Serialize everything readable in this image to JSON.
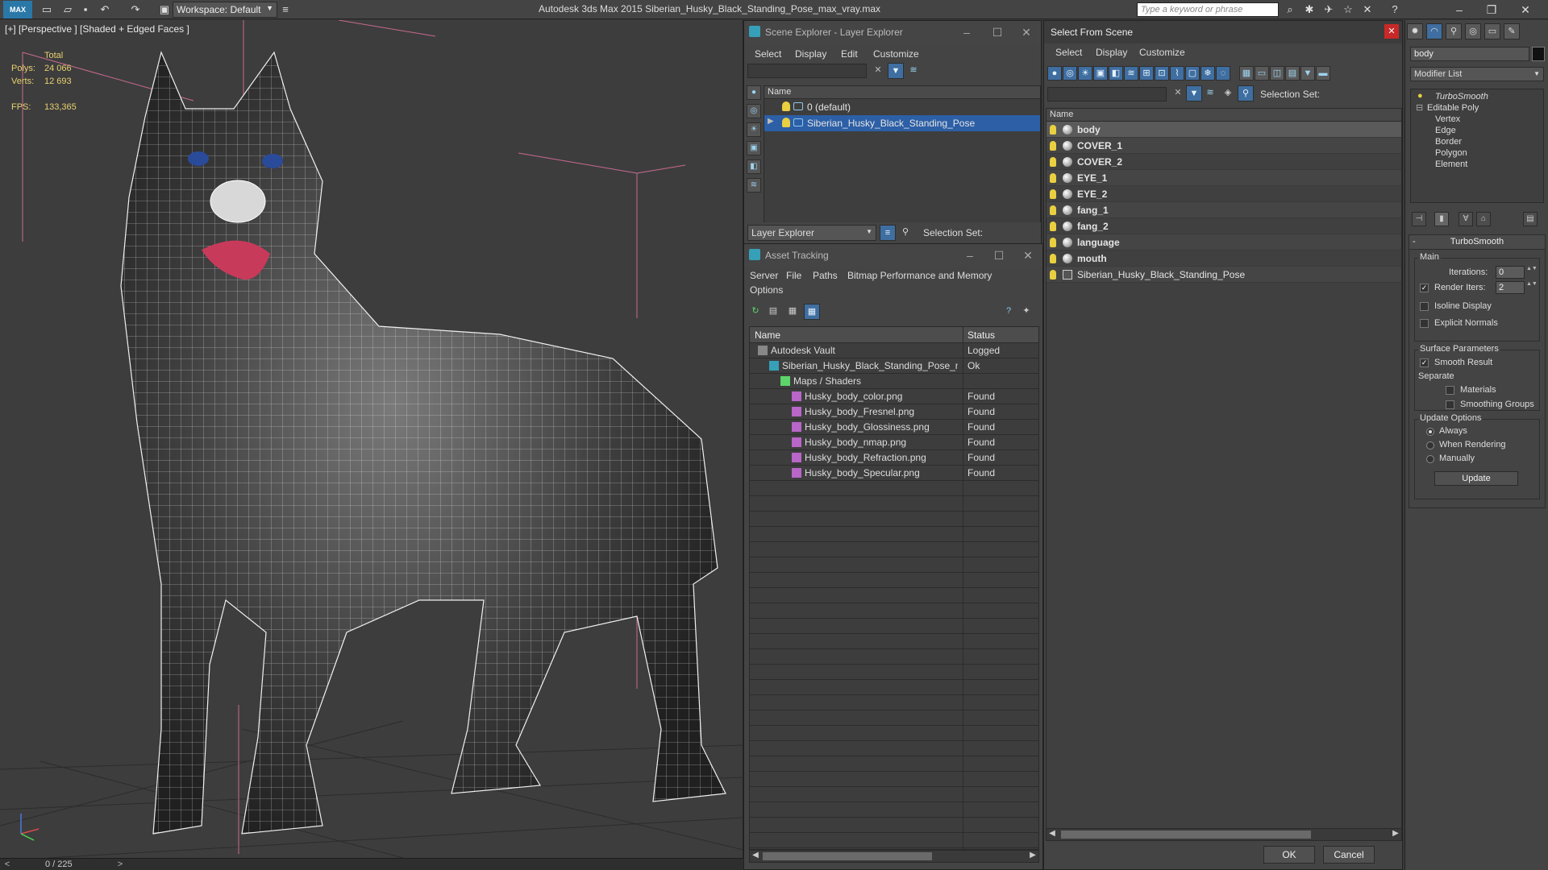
{
  "titlebar": {
    "logo": "MAX",
    "workspace": "Workspace: Default",
    "app_title": "Autodesk 3ds Max  2015    Siberian_Husky_Black_Standing_Pose_max_vray.max",
    "search_placeholder": "Type a keyword or phrase"
  },
  "viewport": {
    "label": "[+] [Perspective ] [Shaded + Edged Faces ]",
    "stats": {
      "total_label": "Total",
      "polys_label": "Polys:",
      "polys_value": "24 066",
      "verts_label": "Verts:",
      "verts_value": "12 693",
      "fps_label": "FPS:",
      "fps_value": "133,365"
    },
    "axis": {
      "x": "x",
      "y": "y",
      "z": "z"
    }
  },
  "timeline": {
    "frame": "0 / 225",
    "prev": "<",
    "next": ">"
  },
  "scene_explorer": {
    "title": "Scene Explorer - Layer Explorer",
    "menu": [
      "Select",
      "Display",
      "Edit",
      "Customize"
    ],
    "column": "Name",
    "rows": [
      {
        "name": "0 (default)",
        "selected": false
      },
      {
        "name": "Siberian_Husky_Black_Standing_Pose",
        "selected": true
      }
    ],
    "explorer_dropdown": "Layer Explorer",
    "selection_set_label": "Selection Set:"
  },
  "asset_tracking": {
    "title": "Asset Tracking",
    "menu": [
      "Server",
      "File",
      "Paths",
      "Bitmap Performance and Memory",
      "Options"
    ],
    "columns": {
      "name": "Name",
      "status": "Status"
    },
    "rows": [
      {
        "name": "Autodesk Vault",
        "status": "Logged",
        "indent": 0,
        "icon": "vault-icon"
      },
      {
        "name": "Siberian_Husky_Black_Standing_Pose_max_vray....",
        "status": "Ok",
        "indent": 1,
        "icon": "max-file-icon"
      },
      {
        "name": "Maps / Shaders",
        "status": "",
        "indent": 2,
        "icon": "maps-icon"
      },
      {
        "name": "Husky_body_color.png",
        "status": "Found",
        "indent": 3,
        "icon": "png-icon"
      },
      {
        "name": "Husky_body_Fresnel.png",
        "status": "Found",
        "indent": 3,
        "icon": "png-icon"
      },
      {
        "name": "Husky_body_Glossiness.png",
        "status": "Found",
        "indent": 3,
        "icon": "png-icon"
      },
      {
        "name": "Husky_body_nmap.png",
        "status": "Found",
        "indent": 3,
        "icon": "png-icon"
      },
      {
        "name": "Husky_body_Refraction.png",
        "status": "Found",
        "indent": 3,
        "icon": "png-icon"
      },
      {
        "name": "Husky_body_Specular.png",
        "status": "Found",
        "indent": 3,
        "icon": "png-icon"
      }
    ]
  },
  "select_from_scene": {
    "title": "Select From Scene",
    "menu": [
      "Select",
      "Display",
      "Customize"
    ],
    "selection_set_label": "Selection Set:",
    "column": "Name",
    "rows": [
      {
        "name": "body",
        "selected": true,
        "kind": "object"
      },
      {
        "name": "COVER_1",
        "selected": false,
        "kind": "object"
      },
      {
        "name": "COVER_2",
        "selected": false,
        "kind": "object"
      },
      {
        "name": "EYE_1",
        "selected": false,
        "kind": "object"
      },
      {
        "name": "EYE_2",
        "selected": false,
        "kind": "object"
      },
      {
        "name": "fang_1",
        "selected": false,
        "kind": "object"
      },
      {
        "name": "fang_2",
        "selected": false,
        "kind": "object"
      },
      {
        "name": "language",
        "selected": false,
        "kind": "object"
      },
      {
        "name": "mouth",
        "selected": false,
        "kind": "object"
      },
      {
        "name": "Siberian_Husky_Black_Standing_Pose",
        "selected": false,
        "kind": "group"
      }
    ],
    "ok": "OK",
    "cancel": "Cancel"
  },
  "command_panel": {
    "object_name": "body",
    "modifier_list": "Modifier List",
    "stack": {
      "turbosmooth": "TurboSmooth",
      "editable_poly": "Editable Poly",
      "sub": [
        "Vertex",
        "Edge",
        "Border",
        "Polygon",
        "Element"
      ]
    },
    "rollout_title": "TurboSmooth",
    "main_label": "Main",
    "iterations_label": "Iterations:",
    "iterations_value": "0",
    "render_iters_label": "Render Iters:",
    "render_iters_value": "2",
    "isoline_label": "Isoline Display",
    "explicit_normals_label": "Explicit Normals",
    "surface_params_label": "Surface Parameters",
    "smooth_result_label": "Smooth Result",
    "separate_label": "Separate",
    "materials_label": "Materials",
    "smoothing_groups_label": "Smoothing Groups",
    "update_options_label": "Update Options",
    "always_label": "Always",
    "when_rendering_label": "When Rendering",
    "manually_label": "Manually",
    "update_button": "Update"
  },
  "colors": {
    "selection_blue": "#2c5fa6",
    "stats_yellow": "#e8d070",
    "close_red": "#c82828"
  }
}
